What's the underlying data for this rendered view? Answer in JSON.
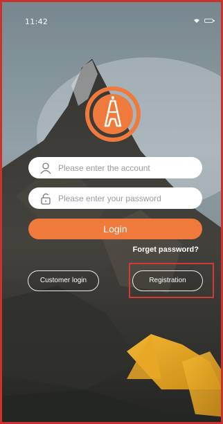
{
  "status_bar": {
    "time": "11:42"
  },
  "brand": {
    "logo_icon": "tower-logo-icon",
    "accent_color": "#f07a3c"
  },
  "login_form": {
    "account_placeholder": "Please enter the account",
    "account_icon": "user-icon",
    "password_placeholder": "Please enter your password",
    "password_icon": "lock-icon",
    "login_label": "Login",
    "forget_password_label": "Forget password?"
  },
  "secondary_actions": {
    "customer_login_label": "Customer login",
    "registration_label": "Registration",
    "highlight_color": "#d33a34"
  }
}
